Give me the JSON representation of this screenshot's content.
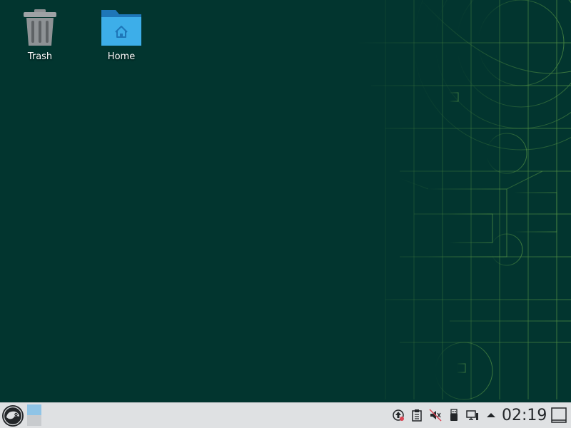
{
  "desktop": {
    "icons": [
      {
        "label": "Trash",
        "icon": "trash-icon"
      },
      {
        "label": "Home",
        "icon": "home-folder-icon"
      }
    ],
    "background_color": "#02352f",
    "wallpaper_line_color": "#3f7a3a"
  },
  "panel": {
    "background_color": "#dfe1e3",
    "launcher_icon": "opensuse-gecko-icon",
    "tray_icons": [
      "updates-icon",
      "clipboard-icon",
      "volume-muted-icon",
      "usb-device-icon",
      "network-icon",
      "expand-tray-arrow-icon"
    ],
    "clock": "02:19",
    "show_desktop_icon": "show-desktop-icon"
  }
}
